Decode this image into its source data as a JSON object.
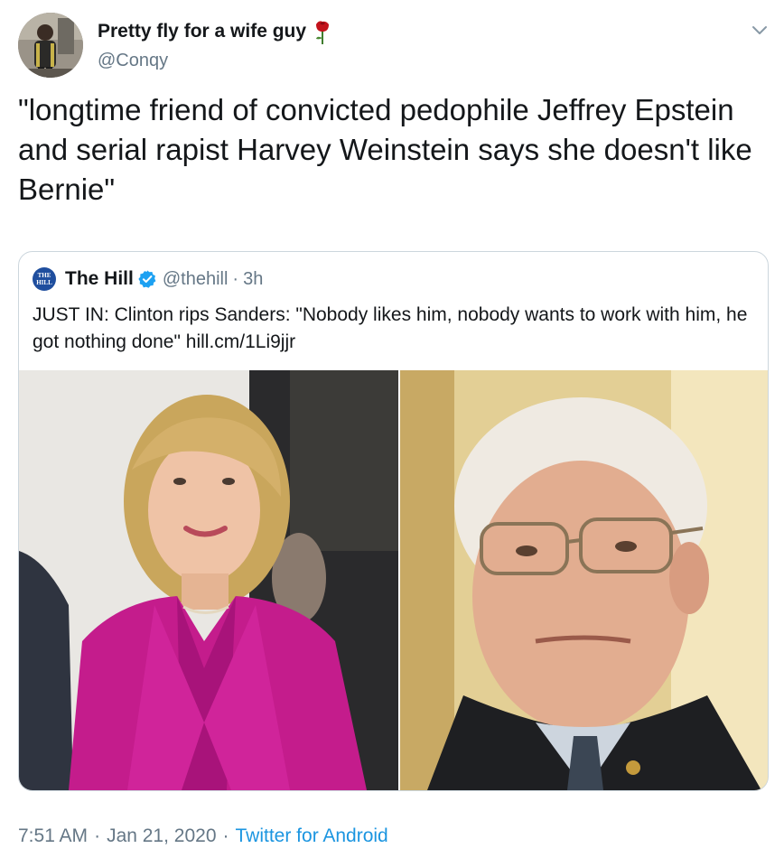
{
  "author": {
    "display_name": "Pretty fly for a wife guy",
    "handle": "@Conqy",
    "name_emoji_icon": "rose-icon"
  },
  "tweet": {
    "text": "\"longtime friend of convicted pedophile Jeffrey Epstein and serial rapist Harvey Weinstein says she doesn't like Bernie\""
  },
  "quoted": {
    "logo_text": "THE HILL",
    "name": "The Hill",
    "verified_icon": "verified-badge-icon",
    "handle": "@thehill",
    "separator": "·",
    "time": "3h",
    "text": "JUST IN: Clinton rips Sanders: \"Nobody likes him, nobody wants to work with him, he got nothing done\" ",
    "link": "hill.cm/1Li9jjr",
    "images": [
      "photo-hillary-clinton",
      "photo-bernie-sanders"
    ]
  },
  "footer": {
    "time": "7:51 AM",
    "separator": "·",
    "date": "Jan 21, 2020",
    "source": "Twitter for Android"
  },
  "colors": {
    "text": "#14171a",
    "secondary": "#657786",
    "link": "#1b95e0",
    "verified": "#1da1f2",
    "border": "#ccd6dd"
  }
}
